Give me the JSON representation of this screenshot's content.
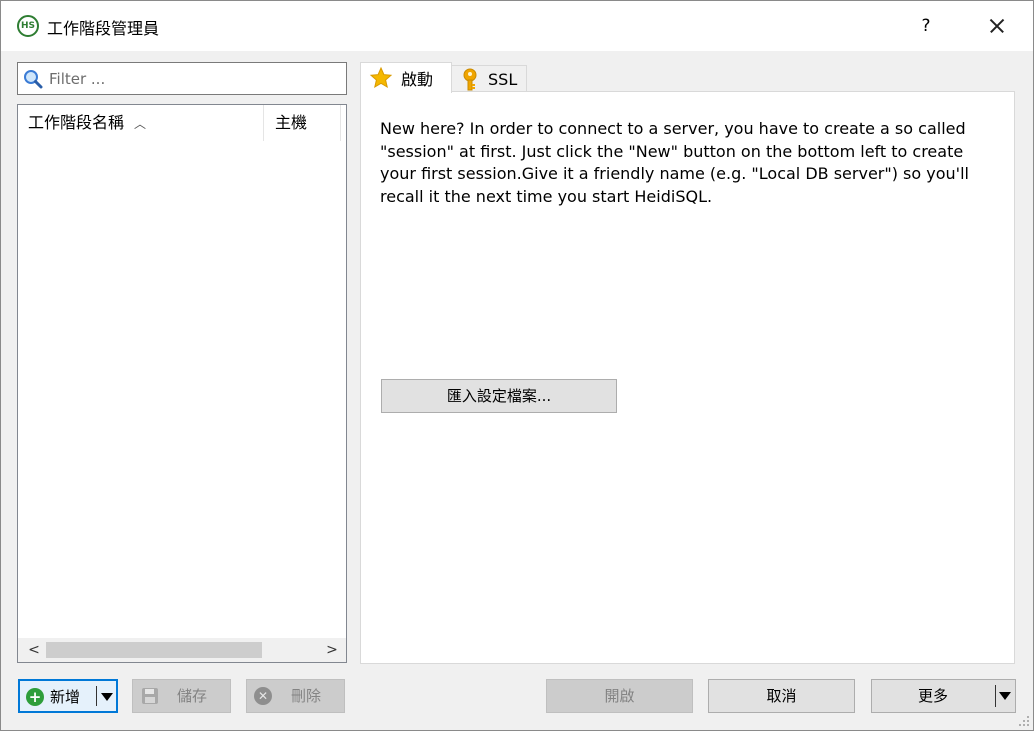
{
  "window": {
    "title": "工作階段管理員",
    "icon_label": "HS",
    "help_label": "?"
  },
  "filter": {
    "placeholder": "Filter ..."
  },
  "session_list": {
    "columns": [
      "工作階段名稱",
      "主機"
    ],
    "sort_indicator": "︿",
    "scroll_left": "<",
    "scroll_right": ">"
  },
  "tabs": [
    {
      "label": "啟動",
      "icon": "star-icon",
      "active": true
    },
    {
      "label": "SSL",
      "icon": "key-icon",
      "active": false
    }
  ],
  "start_tab": {
    "intro_text": "New here? In order to connect to a server, you have to create a so called \"session\" at first. Just click the \"New\" button on the bottom left to create your first session.Give it a friendly name (e.g. \"Local DB server\") so you'll recall it the next time you start HeidiSQL.",
    "import_button": "匯入設定檔案..."
  },
  "buttons": {
    "new": "新增",
    "save": "儲存",
    "delete": "刪除",
    "open": "開啟",
    "cancel": "取消",
    "more": "更多"
  },
  "colors": {
    "accent": "#0078d7",
    "app_icon": "#2e7d32",
    "star": "#f5b800",
    "key": "#f0a500"
  }
}
